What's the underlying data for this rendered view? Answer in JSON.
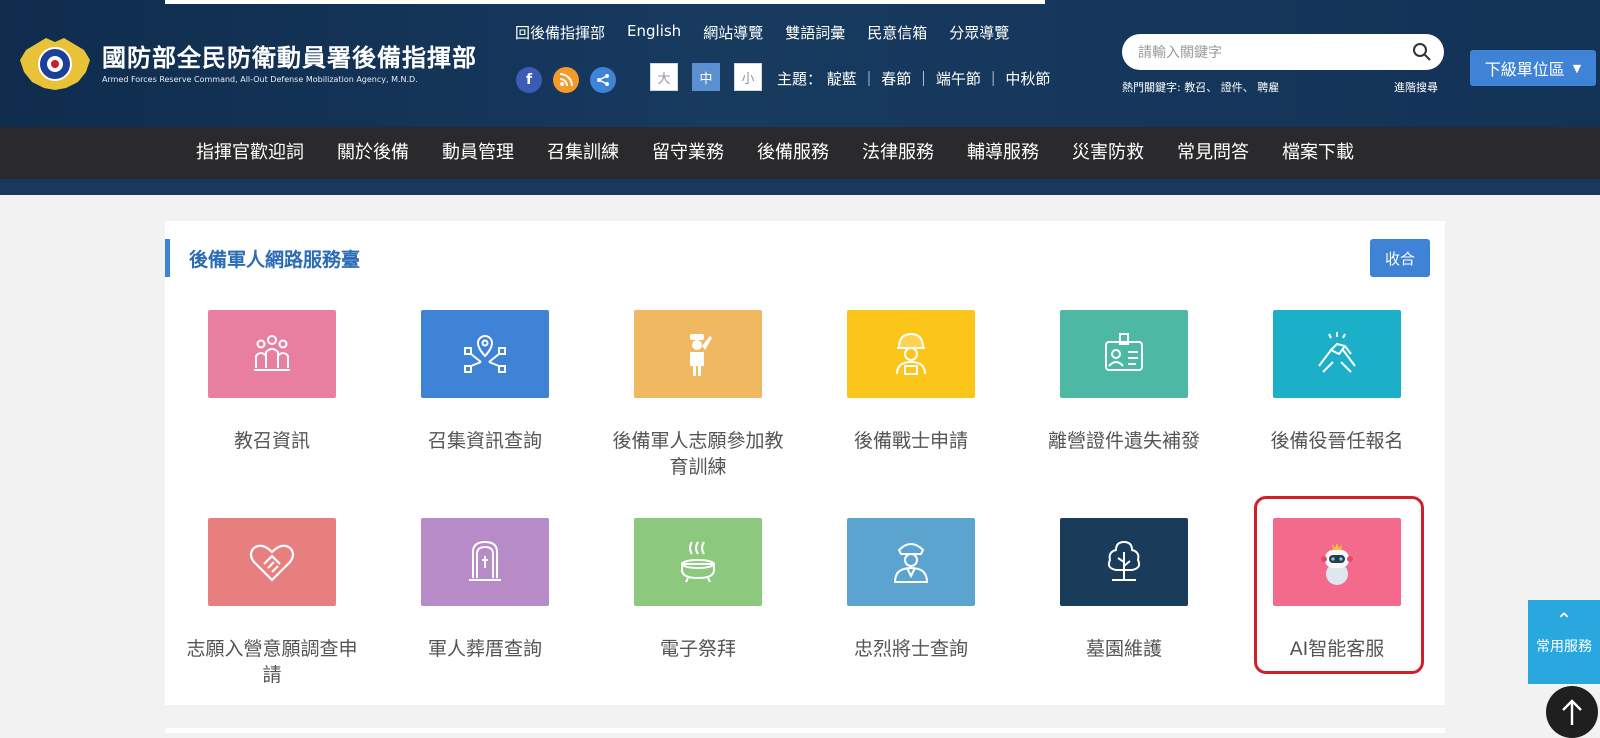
{
  "header": {
    "title_cn": "國防部全民防衛動員署後備指揮部",
    "title_en": "Armed Forces Reserve Command, All-Out Defense Mobilization Agency, M.N.D.",
    "utility_links": [
      "回後備指揮部",
      "English",
      "網站導覽",
      "雙語詞彙",
      "民意信箱",
      "分眾導覽"
    ],
    "social_icons": [
      {
        "name": "facebook-icon",
        "glyph": "f",
        "color": "#3b5bb5"
      },
      {
        "name": "rss-icon",
        "glyph": "◉",
        "color": "#f39a2b"
      },
      {
        "name": "share-icon",
        "glyph": "<",
        "color": "#3f83d6"
      }
    ],
    "font_sizes": [
      "大",
      "中",
      "小"
    ],
    "theme_text": "主題： 靛藍 ｜ 春節 ｜ 端午節 ｜ 中秋節",
    "search": {
      "placeholder": "請輸入關鍵字"
    },
    "hot_keywords": "熱門關鍵字: 教召、 證件、 聘雇",
    "advanced_search": "進階搜尋",
    "subunit_button": "下級單位區"
  },
  "nav": {
    "items": [
      "指揮官歡迎詞",
      "關於後備",
      "動員管理",
      "召集訓練",
      "留守業務",
      "後備服務",
      "法律服務",
      "輔導服務",
      "災害防救",
      "常見問答",
      "檔案下載"
    ]
  },
  "panel": {
    "title": "後備軍人網路服務臺",
    "collapse_label": "收合",
    "tiles": [
      {
        "label": "教召資訊",
        "color": "#e97fa0",
        "icon": "group-people-icon"
      },
      {
        "label": "召集資訊查詢",
        "color": "#3f83d6",
        "icon": "location-network-icon"
      },
      {
        "label": "後備軍人志願參加教育訓練",
        "color": "#f0b860",
        "icon": "salute-soldier-icon"
      },
      {
        "label": "後備戰士申請",
        "color": "#fcc51a",
        "icon": "soldier-helmet-icon"
      },
      {
        "label": "離營證件遺失補發",
        "color": "#4db8a4",
        "icon": "id-card-icon"
      },
      {
        "label": "後備役晉任報名",
        "color": "#1bb0c8",
        "icon": "handshake-icon"
      },
      {
        "label": "志願入營意願調查申請",
        "color": "#e77f7f",
        "icon": "heart-handshake-icon"
      },
      {
        "label": "軍人葬厝查詢",
        "color": "#b78ac8",
        "icon": "tombstone-icon"
      },
      {
        "label": "電子祭拜",
        "color": "#8cc97e",
        "icon": "incense-burner-icon"
      },
      {
        "label": "忠烈將士查詢",
        "color": "#5aa4cf",
        "icon": "officer-icon"
      },
      {
        "label": "墓園維護",
        "color": "#1a3c5b",
        "icon": "tree-icon"
      },
      {
        "label": "AI智能客服",
        "color": "#f46a8d",
        "icon": "robot-mascot-icon"
      }
    ]
  },
  "side": {
    "service_label": "常用服務"
  }
}
